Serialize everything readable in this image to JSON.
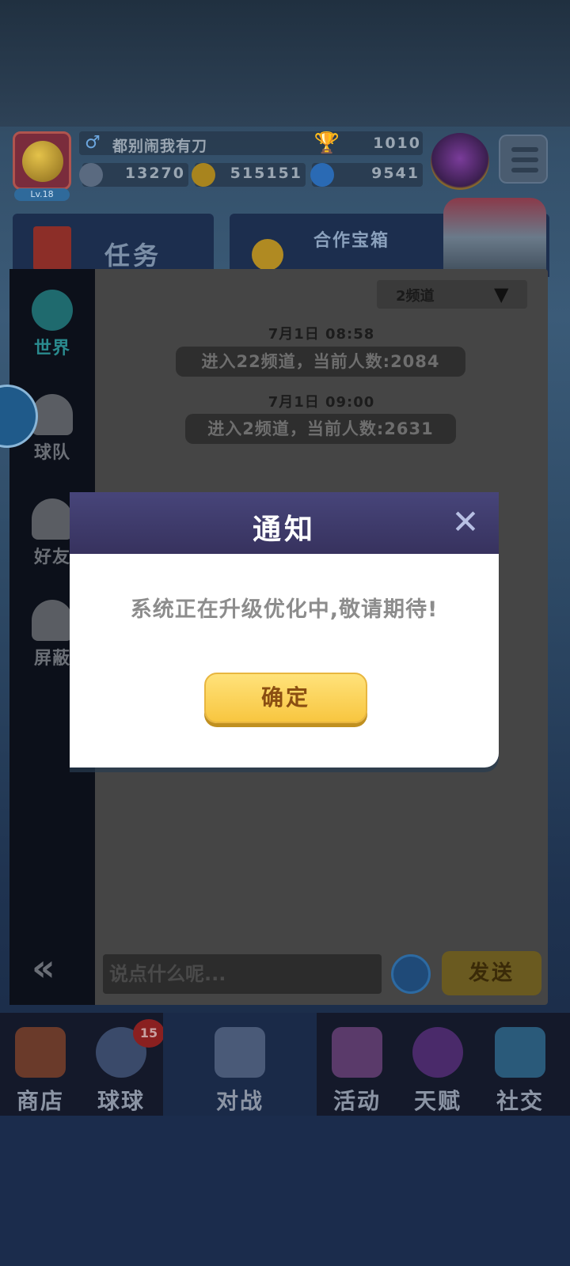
{
  "player": {
    "name": "都别闹我有刀",
    "level": "Lv.18",
    "trophies": "1010",
    "energy": "13270",
    "coins": "515151",
    "gems": "9541"
  },
  "panels": {
    "task": "任务",
    "coop_chest": "合作宝箱"
  },
  "chat": {
    "sidebar": [
      {
        "label": "世界",
        "icon": "globe-icon"
      },
      {
        "label": "球队",
        "icon": "whistle-icon"
      },
      {
        "label": "好友",
        "icon": "friends-icon"
      },
      {
        "label": "屏蔽",
        "icon": "block-user-icon"
      }
    ],
    "channel": "2频道",
    "messages": [
      {
        "time": "7月1日 08:58",
        "text": "进入22频道，当前人数:2084"
      },
      {
        "time": "7月1日 09:00",
        "text": "进入2频道，当前人数:2631"
      }
    ],
    "input_placeholder": "说点什么呢...",
    "send_label": "发送"
  },
  "nav": [
    {
      "label": "商店",
      "icon": "shop-icon"
    },
    {
      "label": "球球",
      "icon": "ball-icon",
      "badge": "15"
    },
    {
      "label": "对战",
      "icon": "battle-icon"
    },
    {
      "label": "活动",
      "icon": "party-icon"
    },
    {
      "label": "天赋",
      "icon": "planet-icon"
    },
    {
      "label": "社交",
      "icon": "social-icon"
    }
  ],
  "modal": {
    "title": "通知",
    "message": "系统正在升级优化中,敬请期待!",
    "confirm_label": "确定"
  }
}
